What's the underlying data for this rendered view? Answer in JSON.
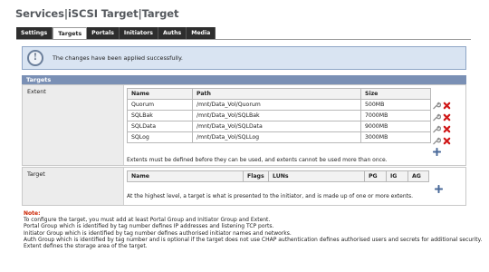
{
  "page": {
    "title": "Services|iSCSI Target|Target"
  },
  "tabs": [
    {
      "label": "Settings",
      "active": false
    },
    {
      "label": "Targets",
      "active": true
    },
    {
      "label": "Portals",
      "active": false
    },
    {
      "label": "Initiators",
      "active": false
    },
    {
      "label": "Auths",
      "active": false
    },
    {
      "label": "Media",
      "active": false
    }
  ],
  "message": {
    "icon": "info-icon",
    "text": "The changes have been applied successfully."
  },
  "section": {
    "title": "Targets"
  },
  "extent": {
    "label": "Extent",
    "columns": {
      "name": "Name",
      "path": "Path",
      "size": "Size"
    },
    "rows": [
      {
        "name": "Quorum",
        "path": "/mnt/Data_Vol/Quorum",
        "size": "500MB"
      },
      {
        "name": "SQLBak",
        "path": "/mnt/Data_Vol/SQLBak",
        "size": "7000MB"
      },
      {
        "name": "SQLData",
        "path": "/mnt/Data_Vol/SQLData",
        "size": "9000MB"
      },
      {
        "name": "SQLog",
        "path": "/mnt/Data_Vol/SQLLog",
        "size": "3000MB"
      }
    ],
    "note": "Extents must be defined before they can be used, and extents cannot be used more than once."
  },
  "target": {
    "label": "Target",
    "columns": {
      "name": "Name",
      "flags": "Flags",
      "luns": "LUNs",
      "pg": "PG",
      "ig": "IG",
      "ag": "AG"
    },
    "note": "At the highest level, a target is what is presented to the initiator, and is made up of one or more extents."
  },
  "note": {
    "title": "Note:",
    "lines": [
      "To configure the target, you must add at least Portal Group and Initiator Group and Extent.",
      "Portal Group which is identified by tag number defines IP addresses and listening TCP ports.",
      "Initiator Group which is identified by tag number defines authorised initiator names and networks.",
      "Auth Group which is identified by tag number and is optional if the target does not use CHAP authentication defines authorised users and secrets for additional security.",
      "Extent defines the storage area of the target."
    ]
  },
  "colors": {
    "tab_bg": "#2e2e2e",
    "message_bg": "#d9e4f2",
    "section_header_bg": "#7a90b5",
    "note_title": "#cc2200",
    "delete_icon": "#d01818"
  },
  "icons": {
    "edit": "wrench-icon",
    "delete": "delete-x-icon",
    "add": "add-plus-icon"
  }
}
